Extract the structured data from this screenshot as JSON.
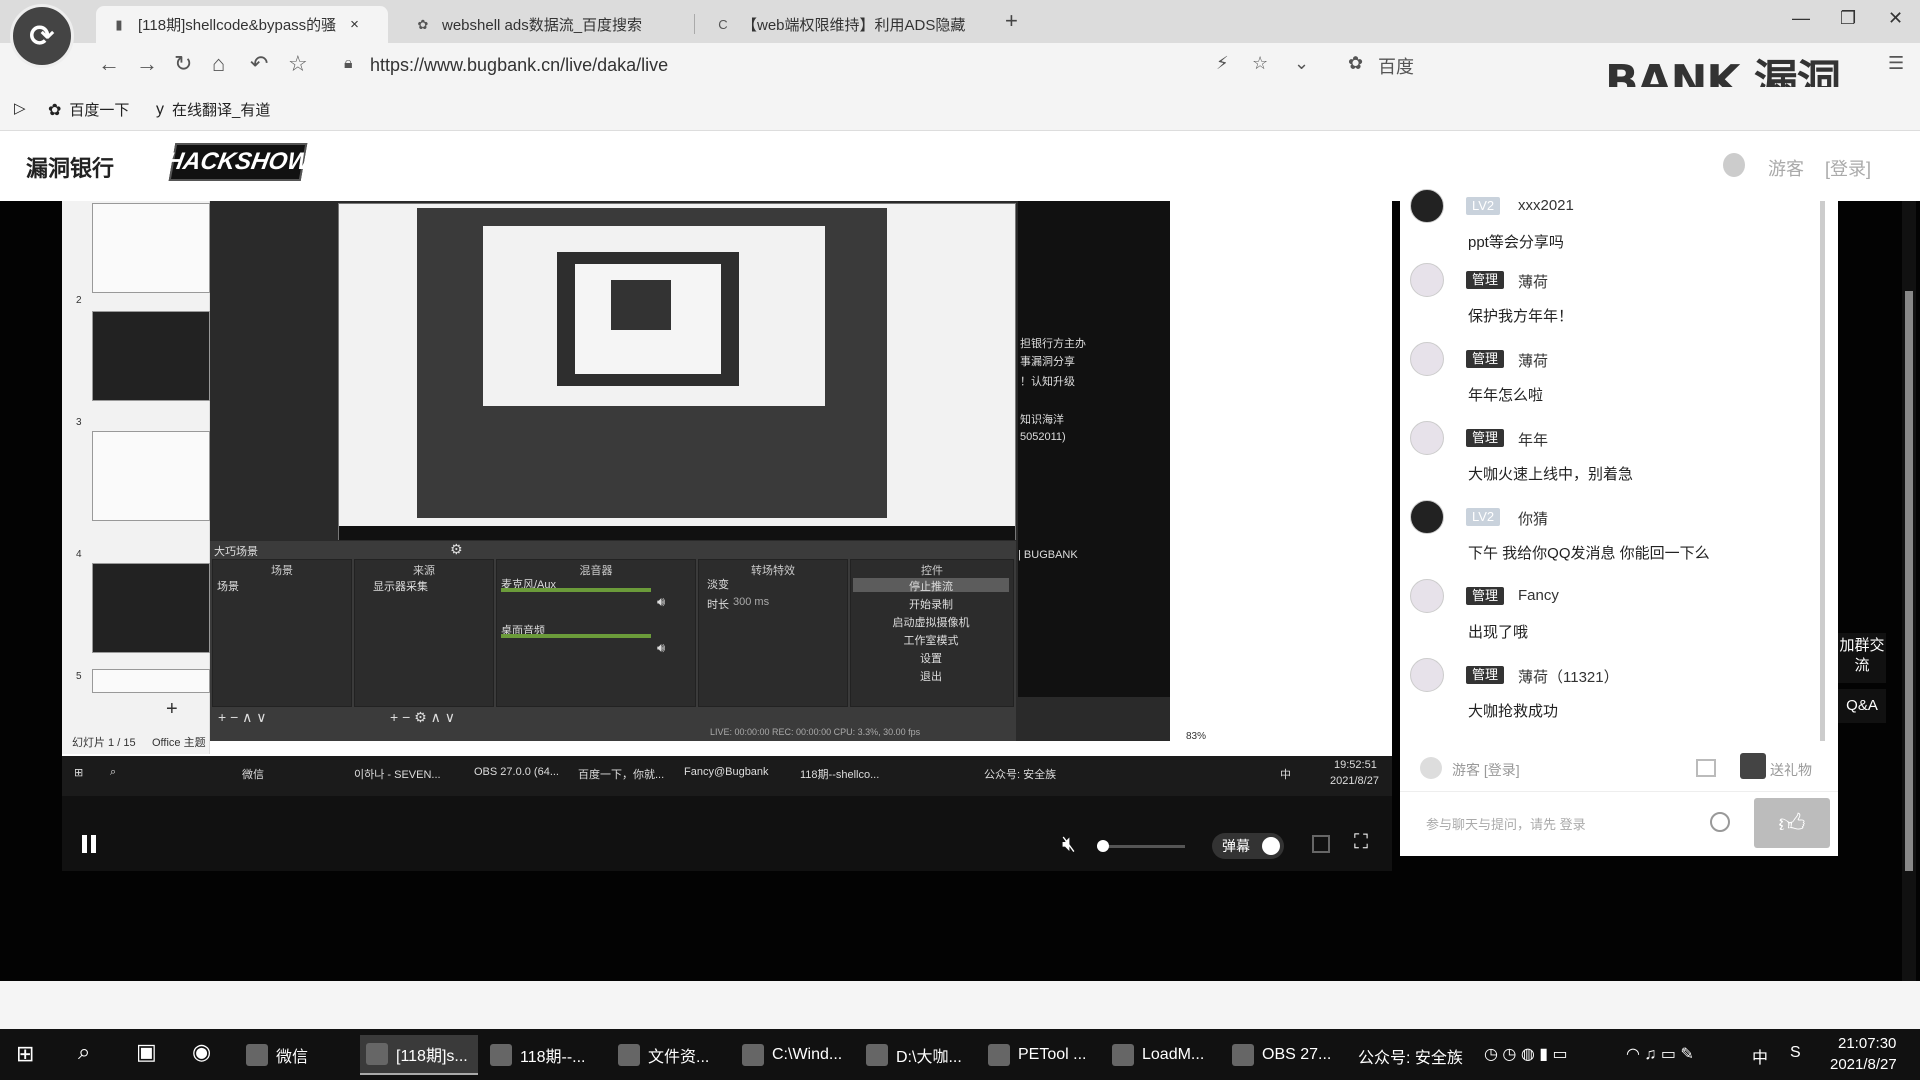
{
  "browser": {
    "tabs": [
      {
        "label": "[118期]shellcode&bypass的骚",
        "icon": "page-icon",
        "active": true
      },
      {
        "label": "webshell ads数据流_百度搜索",
        "icon": "baidu-icon",
        "active": false
      },
      {
        "label": "【web端权限维持】利用ADS隐藏",
        "icon": "c-icon",
        "active": false
      }
    ],
    "close_tab": "×",
    "new_tab": "+",
    "url": "https://www.bugbank.cn/live/daka/live",
    "search_hint": "百度",
    "watermark": "BANK 漏洞"
  },
  "bookmarks": [
    {
      "label": "百度一下",
      "icon": "paw-icon"
    },
    {
      "label": "在线翻译_有道",
      "icon": "youdao-icon"
    }
  ],
  "site": {
    "logo": "漏洞银行",
    "hackshow": "HACKSHOW",
    "guest": "游客",
    "login": "[登录]"
  },
  "video": {
    "slide_numbers": [
      "2",
      "3",
      "4",
      "5"
    ],
    "slide_counter": "幻灯片 1 / 15",
    "slide_theme": "Office 主题",
    "right_slide_lines": [
      "担银行方主办",
      "事漏洞分享",
      "！认知升级",
      "知识海洋",
      "5052011)",
      "| BUGBANK"
    ],
    "obs": {
      "dock_title": "大巧场景",
      "scenes_head": "场景",
      "sources_head": "来源",
      "mixer_head": "混音器",
      "transitions_head": "转场特效",
      "controls_head": "控件",
      "scene_item": "场景",
      "source_item": "显示器采集",
      "mixer_items": [
        "麦克风/Aux",
        "桌面音频"
      ],
      "transition_item": "淡变",
      "duration_label": "时长",
      "duration_value": "300 ms",
      "controls": [
        "停止推流",
        "开始录制",
        "启动虚拟摄像机",
        "工作室模式",
        "设置",
        "退出"
      ],
      "status": "LIVE: 00:00:00    REC: 00:00:00    CPU: 3.3%, 30.00 fps",
      "zoom": "83%"
    },
    "stream_taskbar": {
      "items": [
        "微信",
        "이하나 - SEVEN...",
        "OBS 27.0.0 (64...",
        "百度一下，你就...",
        "Fancy@Bugbank",
        "118期--shellco..."
      ],
      "tray_text": "公众号: 安全族",
      "ime": "中",
      "time": "19:52:51",
      "date": "2021/8/27"
    }
  },
  "player": {
    "danmu_label": "弹幕",
    "volume_level": 0.05
  },
  "chat": {
    "messages": [
      {
        "badge": "LV2",
        "user": "xxx2021",
        "text": "ppt等会分享吗",
        "badge_style": "light",
        "avatar": "dark"
      },
      {
        "badge": "管理",
        "user": "薄荷",
        "text": "保护我方年年！",
        "badge_style": "dark",
        "avatar": "light"
      },
      {
        "badge": "管理",
        "user": "薄荷",
        "text": "年年怎么啦",
        "badge_style": "dark",
        "avatar": "light"
      },
      {
        "badge": "管理",
        "user": "年年",
        "text": "大咖火速上线中，别着急",
        "badge_style": "dark",
        "avatar": "light"
      },
      {
        "badge": "LV2",
        "user": "你猜",
        "text": "下午 我给你QQ发消息 你能回一下么",
        "badge_style": "light",
        "avatar": "dark"
      },
      {
        "badge": "管理",
        "user": "Fancy",
        "text": "出现了哦",
        "badge_style": "dark",
        "avatar": "light"
      },
      {
        "badge": "管理",
        "user": "薄荷（11321）",
        "text": "大咖抢救成功",
        "badge_style": "dark",
        "avatar": "light"
      }
    ],
    "guest_line": "游客 [登录]",
    "gift_label": "送礼物",
    "input_placeholder": "参与聊天与提问，请先 登录",
    "side_group": "加群交流",
    "side_qa": "Q&A"
  },
  "taskbar": {
    "apps": [
      {
        "label": "微信",
        "icon": "wechat-icon",
        "active": false
      },
      {
        "label": "[118期]s...",
        "icon": "browser-icon",
        "active": true
      },
      {
        "label": "118期--...",
        "icon": "video-icon",
        "active": false
      },
      {
        "label": "文件资...",
        "icon": "folder-icon",
        "active": false
      },
      {
        "label": "C:\\Wind...",
        "icon": "cmd-icon",
        "active": false
      },
      {
        "label": "D:\\大咖...",
        "icon": "tool-icon",
        "active": false
      },
      {
        "label": "PETool ...",
        "icon": "petool-icon",
        "active": false
      },
      {
        "label": "LoadM...",
        "icon": "vs-icon",
        "active": false
      },
      {
        "label": "OBS 27...",
        "icon": "obs-icon",
        "active": false
      }
    ],
    "tray_text": "公众号: 安全族",
    "ime": "中",
    "time": "21:07:30",
    "date": "2021/8/27"
  }
}
